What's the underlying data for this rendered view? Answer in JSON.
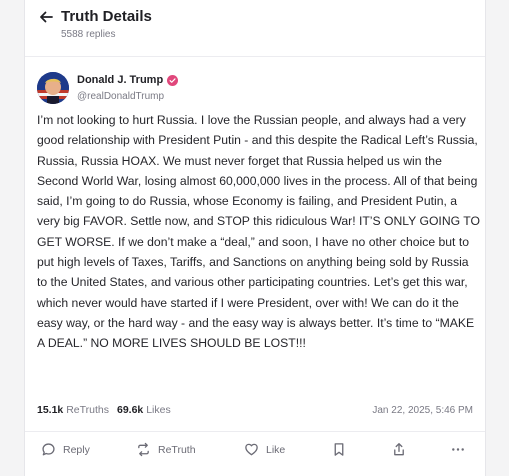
{
  "header": {
    "title": "Truth Details",
    "replies": "5588 replies"
  },
  "author": {
    "name": "Donald J. Trump",
    "handle": "@realDonaldTrump"
  },
  "post": {
    "text": "I’m not looking to hurt Russia. I love the Russian people, and always had a very good relationship with President Putin - and this despite the Radical Left’s Russia, Russia, Russia HOAX. We must never forget that Russia helped us win the Second World War, losing almost 60,000,000 lives in the process. All of that being said, I’m going to do Russia, whose Economy is failing, and President Putin, a very big FAVOR. Settle now, and STOP this ridiculous War! IT’S ONLY GOING TO GET WORSE. If we don’t make a “deal,” and soon, I have no other choice but to put high levels of Taxes, Tariffs, and Sanctions on anything being sold by Russia to the United States, and various other participating countries. Let’s get this war, which never would have started if I were President, over with! We can do it the easy way, or the hard way - and the easy way is always better. It’s time to “MAKE A DEAL.” NO MORE LIVES SHOULD BE LOST!!!"
  },
  "stats": {
    "retruths_count": "15.1k",
    "retruths_label": "ReTruths",
    "likes_count": "69.6k",
    "likes_label": "Likes",
    "timestamp": "Jan 22, 2025, 5:46 PM"
  },
  "actions": {
    "reply": "Reply",
    "retruth": "ReTruth",
    "like": "Like"
  },
  "icons": {
    "back": "arrow-left-icon",
    "verified": "verified-badge-icon",
    "reply": "speech-bubble-icon",
    "retruth": "repost-arrows-icon",
    "like": "heart-icon",
    "bookmark": "bookmark-icon",
    "share": "share-icon",
    "more": "more-dots-icon"
  },
  "colors": {
    "verified": "#e0477b",
    "text": "#26262b",
    "muted": "#7a7a85"
  }
}
